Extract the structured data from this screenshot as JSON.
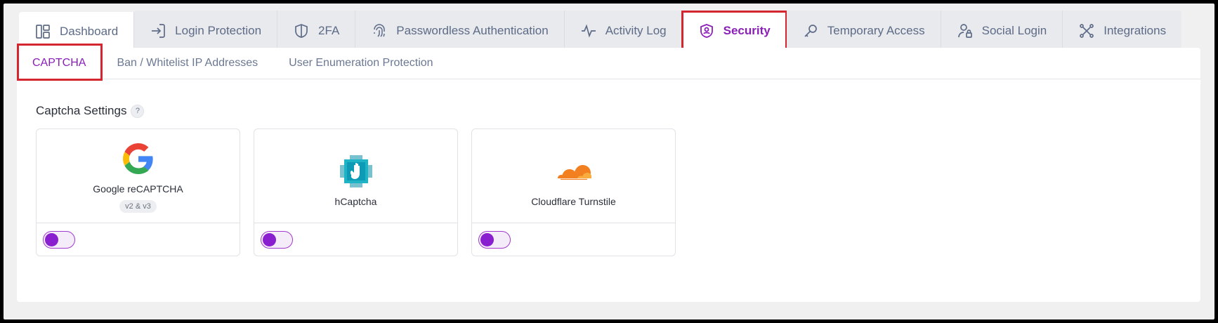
{
  "top_tabs": [
    {
      "label": "Dashboard",
      "icon": "dashboard-icon"
    },
    {
      "label": "Login Protection",
      "icon": "login-icon"
    },
    {
      "label": "2FA",
      "icon": "shield-icon"
    },
    {
      "label": "Passwordless Authentication",
      "icon": "fingerprint-icon"
    },
    {
      "label": "Activity Log",
      "icon": "activity-icon"
    },
    {
      "label": "Security",
      "icon": "user-shield-icon"
    },
    {
      "label": "Temporary Access",
      "icon": "key-icon"
    },
    {
      "label": "Social Login",
      "icon": "user-lock-icon"
    },
    {
      "label": "Integrations",
      "icon": "integrations-icon"
    }
  ],
  "sub_tabs": [
    {
      "label": "CAPTCHA"
    },
    {
      "label": "Ban / Whitelist IP Addresses"
    },
    {
      "label": "User Enumeration Protection"
    }
  ],
  "section": {
    "title": "Captcha Settings",
    "help": "?"
  },
  "providers": [
    {
      "name": "Google reCAPTCHA",
      "badge": "v2 & v3",
      "icon": "google-logo",
      "enabled": false
    },
    {
      "name": "hCaptcha",
      "icon": "hcaptcha-logo",
      "enabled": false
    },
    {
      "name": "Cloudflare Turnstile",
      "icon": "cloudflare-logo",
      "enabled": false
    }
  ],
  "colors": {
    "accent": "#8a1fb8",
    "highlight": "#d4262e",
    "toggle_knob": "#8a1fd0"
  }
}
